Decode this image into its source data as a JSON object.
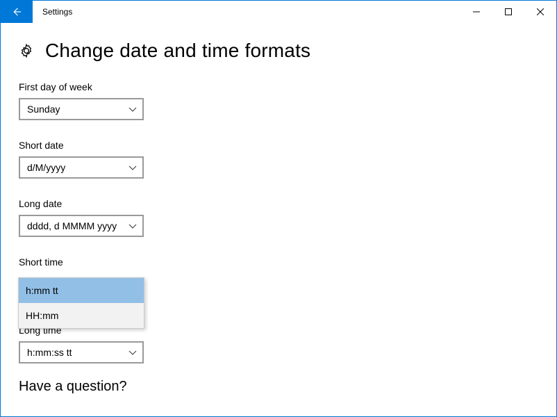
{
  "window": {
    "title": "Settings"
  },
  "page": {
    "heading": "Change date and time formats"
  },
  "fields": {
    "first_day": {
      "label": "First day of week",
      "value": "Sunday"
    },
    "short_date": {
      "label": "Short date",
      "value": "d/M/yyyy"
    },
    "long_date": {
      "label": "Long date",
      "value": "dddd, d MMMM yyyy"
    },
    "short_time": {
      "label": "Short time",
      "options": [
        "h:mm tt",
        "HH:mm"
      ],
      "selected_index": 0
    },
    "long_time": {
      "label": "Long time",
      "value": "h:mm:ss tt"
    }
  },
  "help": {
    "heading": "Have a question?"
  }
}
